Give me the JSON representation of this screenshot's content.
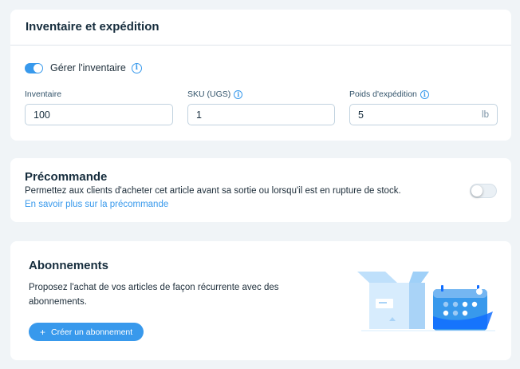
{
  "inventory": {
    "title": "Inventaire et expédition",
    "manage_toggle_label": "Gérer l'inventaire",
    "manage_toggle_on": true,
    "fields": {
      "inventory": {
        "label": "Inventaire",
        "value": "100"
      },
      "sku": {
        "label": "SKU (UGS)",
        "value": "1"
      },
      "weight": {
        "label": "Poids d'expédition",
        "value": "5",
        "unit": "lb"
      }
    }
  },
  "preorder": {
    "title": "Précommande",
    "description": "Permettez aux clients d'acheter cet article avant sa sortie ou lorsqu'il est en rupture de stock.",
    "link": "En savoir plus sur la précommande",
    "toggle_on": false
  },
  "subscriptions": {
    "title": "Abonnements",
    "description": "Proposez l'achat de vos articles de façon récurrente avec des abonnements.",
    "button_label": "Créer un abonnement",
    "button_icon": "plus-icon"
  },
  "colors": {
    "accent": "#3899ec",
    "background": "#f0f4f7",
    "text": "#162d3d"
  }
}
